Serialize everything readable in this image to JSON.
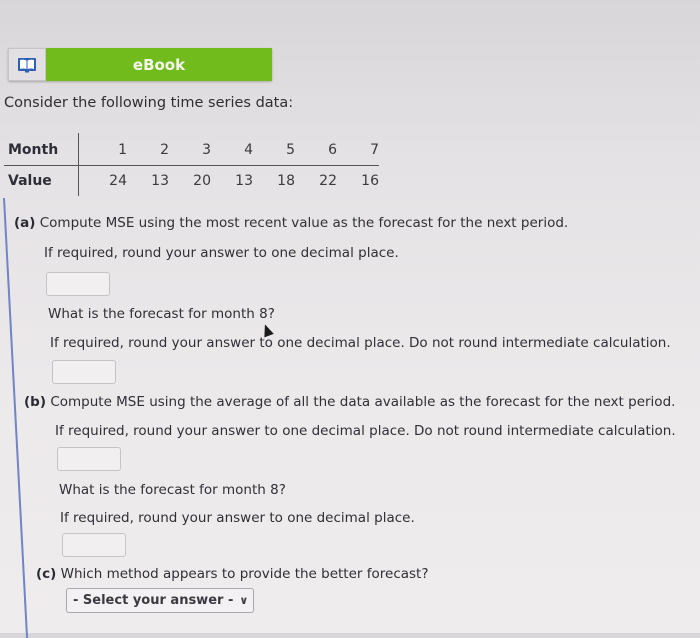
{
  "ebook": {
    "icon": "book-icon",
    "label": "eBook",
    "color": "#72bb1d"
  },
  "intro": "Consider the following time series data:",
  "table": {
    "row_headers": [
      "Month",
      "Value"
    ],
    "months": [
      "1",
      "2",
      "3",
      "4",
      "5",
      "6",
      "7"
    ],
    "values": [
      "24",
      "13",
      "20",
      "13",
      "18",
      "22",
      "16"
    ]
  },
  "part_a": {
    "label": "(a)",
    "question": "Compute MSE using the most recent value as the forecast for the next period.",
    "instruction": "If required, round your answer to one decimal place.",
    "answer": "",
    "followup_question": "What is the forecast for month 8?",
    "followup_instruction": "If required, round your answer to one decimal place. Do not round intermediate calculation.",
    "followup_answer": ""
  },
  "part_b": {
    "label": "(b)",
    "question": "Compute MSE using the average of all the data available as the forecast for the next period.",
    "instruction": "If required, round your answer to one decimal place. Do not round intermediate calculation.",
    "answer": "",
    "followup_question": "What is the forecast for month 8?",
    "followup_instruction": "If required, round your answer to one decimal place.",
    "followup_answer": ""
  },
  "part_c": {
    "label": "(c)",
    "question": "Which method appears to provide the better forecast?",
    "select_value": "- Select your answer -",
    "chevron_icon": "chevron-down-icon"
  }
}
